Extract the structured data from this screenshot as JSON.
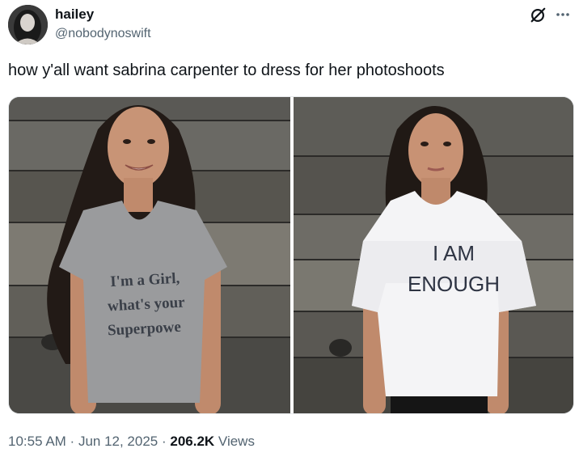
{
  "author": {
    "display_name": "hailey",
    "handle": "@nobodynoswift"
  },
  "tweet": {
    "text": "how y'all want sabrina carpenter to dress for her photoshoots"
  },
  "media": {
    "left_shirt": {
      "line1": "I'm a Girl,",
      "line2": "what's your",
      "line3": "Superpowe",
      "shirt_color": "#9a9b9d",
      "text_color": "#3a3f48"
    },
    "right_shirt": {
      "line1": "I AM",
      "line2": "ENOUGH",
      "shirt_color": "#f4f4f6",
      "text_color": "#2e3443"
    },
    "wood_color": "#5b5a57"
  },
  "meta": {
    "time": "10:55 AM",
    "sep1": " · ",
    "date": "Jun 12, 2025",
    "sep2": " · ",
    "views_count": "206.2K",
    "views_label": " Views"
  },
  "icons": {
    "grok": "grok-icon",
    "more": "more-icon"
  }
}
